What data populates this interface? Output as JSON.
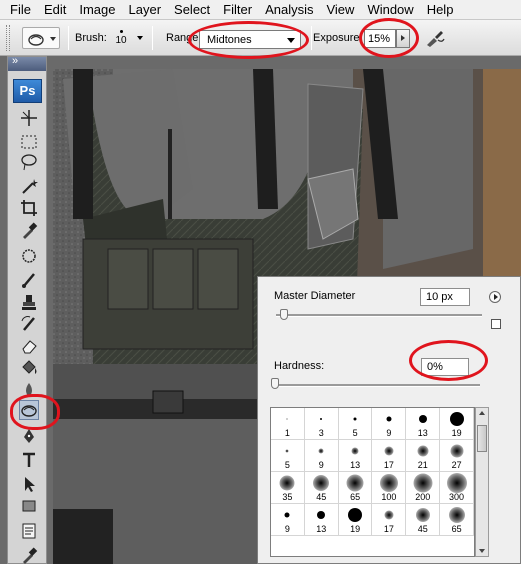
{
  "menu": [
    "File",
    "Edit",
    "Image",
    "Layer",
    "Select",
    "Filter",
    "Analysis",
    "View",
    "Window",
    "Help"
  ],
  "options": {
    "tool_icon": "burn-tool-icon",
    "brush_label": "Brush:",
    "brush_size": "10",
    "range_label": "Range:",
    "range_value": "Midtones",
    "exposure_label": "Exposure:",
    "exposure_value": "15%",
    "airbrush_icon": "airbrush-icon"
  },
  "toolbox": {
    "logo": "Ps",
    "tools": [
      "move-tool-icon",
      "marquee-tool-icon",
      "lasso-tool-icon",
      "magic-wand-icon",
      "crop-tool-icon",
      "eyedropper-icon",
      "healing-brush-icon",
      "brush-tool-icon",
      "clone-stamp-icon",
      "history-brush-icon",
      "eraser-icon",
      "paint-bucket-icon",
      "blur-tool-icon",
      "burn-tool-icon",
      "pen-tool-icon",
      "type-tool-icon",
      "path-selection-icon",
      "rectangle-tool-icon",
      "notes-tool-icon",
      "eyedropper-2-icon"
    ],
    "selected_tool": "burn-tool-icon"
  },
  "brush_panel": {
    "master_diameter_label": "Master Diameter",
    "master_diameter_value": "10 px",
    "hardness_label": "Hardness:",
    "hardness_value": "0%",
    "presets": [
      {
        "label": "1",
        "size": 1,
        "soft": false
      },
      {
        "label": "3",
        "size": 2,
        "soft": false
      },
      {
        "label": "5",
        "size": 3,
        "soft": false
      },
      {
        "label": "9",
        "size": 5,
        "soft": false
      },
      {
        "label": "13",
        "size": 8,
        "soft": false
      },
      {
        "label": "19",
        "size": 14,
        "soft": false
      },
      {
        "label": "5",
        "size": 3,
        "soft": true
      },
      {
        "label": "9",
        "size": 5,
        "soft": true
      },
      {
        "label": "13",
        "size": 7,
        "soft": true
      },
      {
        "label": "17",
        "size": 9,
        "soft": true
      },
      {
        "label": "21",
        "size": 11,
        "soft": true
      },
      {
        "label": "27",
        "size": 13,
        "soft": true
      },
      {
        "label": "35",
        "size": 15,
        "soft": true
      },
      {
        "label": "45",
        "size": 16,
        "soft": true
      },
      {
        "label": "65",
        "size": 17,
        "soft": true
      },
      {
        "label": "100",
        "size": 18,
        "soft": true
      },
      {
        "label": "200",
        "size": 19,
        "soft": true
      },
      {
        "label": "300",
        "size": 20,
        "soft": true
      },
      {
        "label": "9",
        "size": 5,
        "soft": false
      },
      {
        "label": "13",
        "size": 8,
        "soft": false
      },
      {
        "label": "19",
        "size": 14,
        "soft": false
      },
      {
        "label": "17",
        "size": 9,
        "soft": true
      },
      {
        "label": "45",
        "size": 14,
        "soft": true
      },
      {
        "label": "65",
        "size": 16,
        "soft": true
      }
    ]
  }
}
